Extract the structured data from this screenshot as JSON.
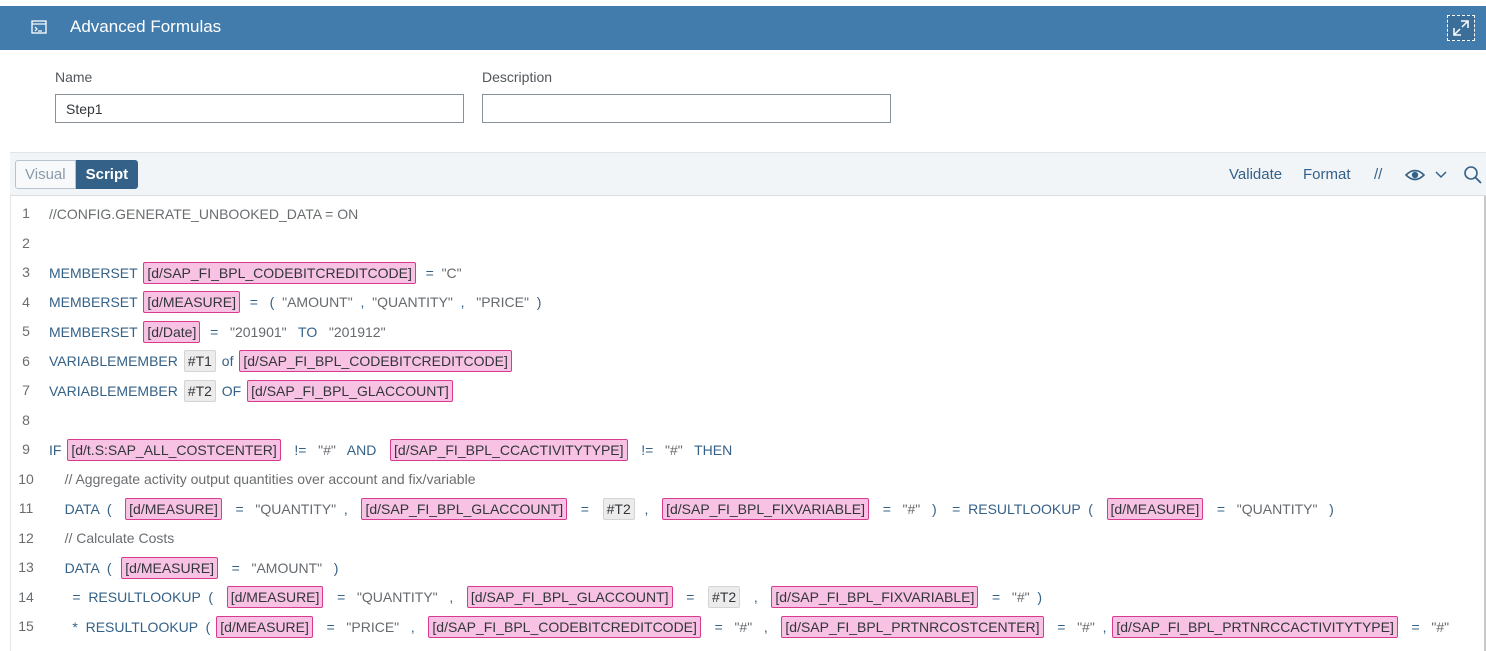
{
  "header": {
    "title": "Advanced Formulas",
    "title_icon": "console-icon",
    "expand_icon": "expand-icon"
  },
  "form": {
    "name_label": "Name",
    "name_value": "Step1",
    "description_label": "Description",
    "description_value": ""
  },
  "toolbar": {
    "tabs": [
      {
        "label": "Visual",
        "selected": false
      },
      {
        "label": "Script",
        "selected": true
      }
    ],
    "validate": "Validate",
    "format": "Format",
    "comment": "//",
    "icons": [
      "eye-icon",
      "chevron-down-icon",
      "search-icon"
    ]
  },
  "editor": {
    "lines": [
      {
        "n": "1",
        "indent": "",
        "tokens": [
          [
            "c",
            "//CONFIG.GENERATE_UNBOOKED_DATA = ON"
          ]
        ]
      },
      {
        "n": "2",
        "indent": "",
        "tokens": []
      },
      {
        "n": "3",
        "indent": "",
        "tokens": [
          [
            "k",
            "MEMBERSET "
          ],
          [
            "d",
            "[d/SAP_FI_BPL_CODEBITCREDITCODE]"
          ],
          [
            "o",
            "  =  "
          ],
          [
            "s",
            "\"C\""
          ]
        ]
      },
      {
        "n": "4",
        "indent": "",
        "tokens": [
          [
            "k",
            "MEMBERSET "
          ],
          [
            "d",
            "[d/MEASURE]"
          ],
          [
            "o",
            "  =   (  "
          ],
          [
            "s",
            "\"AMOUNT\""
          ],
          [
            "o",
            "  ,  "
          ],
          [
            "s",
            "\"QUANTITY\""
          ],
          [
            "o",
            "  ,   "
          ],
          [
            "s",
            "\"PRICE\""
          ],
          [
            "o",
            "  )"
          ]
        ]
      },
      {
        "n": "5",
        "indent": "",
        "tokens": [
          [
            "k",
            "MEMBERSET "
          ],
          [
            "d",
            "[d/Date]"
          ],
          [
            "o",
            "  =   "
          ],
          [
            "s",
            "\"201901\""
          ],
          [
            "k",
            "   TO   "
          ],
          [
            "s",
            "\"201912\""
          ]
        ]
      },
      {
        "n": "6",
        "indent": "",
        "tokens": [
          [
            "k",
            "VARIABLEMEMBER "
          ],
          [
            "v",
            "#T1"
          ],
          [
            "k",
            " of "
          ],
          [
            "d",
            "[d/SAP_FI_BPL_CODEBITCREDITCODE]"
          ]
        ]
      },
      {
        "n": "7",
        "indent": "",
        "tokens": [
          [
            "k",
            "VARIABLEMEMBER "
          ],
          [
            "v",
            "#T2"
          ],
          [
            "k",
            " OF "
          ],
          [
            "d",
            "[d/SAP_FI_BPL_GLACCOUNT]"
          ]
        ]
      },
      {
        "n": "8",
        "indent": "",
        "tokens": []
      },
      {
        "n": "9",
        "indent": "",
        "tokens": [
          [
            "k",
            "IF "
          ],
          [
            "d",
            "[d/t.S:SAP_ALL_COSTCENTER]"
          ],
          [
            "o",
            "   !=   "
          ],
          [
            "s",
            "\"#\""
          ],
          [
            "k",
            "   AND   "
          ],
          [
            "d",
            "[d/SAP_FI_BPL_CCACTIVITYTYPE]"
          ],
          [
            "o",
            "   !=   "
          ],
          [
            "s",
            "\"#\""
          ],
          [
            "k",
            "   THEN"
          ]
        ]
      },
      {
        "n": "10",
        "indent": "    ",
        "tokens": [
          [
            "c",
            "// Aggregate activity output quantities over account and fix/variable"
          ]
        ]
      },
      {
        "n": "11",
        "indent": "    ",
        "tokens": [
          [
            "k",
            "DATA  (   "
          ],
          [
            "d",
            "[d/MEASURE]"
          ],
          [
            "o",
            "   =   "
          ],
          [
            "s",
            "\"QUANTITY\""
          ],
          [
            "o",
            "  ,   "
          ],
          [
            "d",
            "[d/SAP_FI_BPL_GLACCOUNT]"
          ],
          [
            "o",
            "   =   "
          ],
          [
            "v",
            "#T2"
          ],
          [
            "o",
            "  ,   "
          ],
          [
            "d",
            "[d/SAP_FI_BPL_FIXVARIABLE]"
          ],
          [
            "o",
            "   =   "
          ],
          [
            "s",
            "\"#\""
          ],
          [
            "o",
            "   )    =  "
          ],
          [
            "k",
            "RESULTLOOKUP  (   "
          ],
          [
            "d",
            "[d/MEASURE]"
          ],
          [
            "o",
            "   =   "
          ],
          [
            "s",
            "\"QUANTITY\""
          ],
          [
            "o",
            "   )"
          ]
        ]
      },
      {
        "n": "12",
        "indent": "    ",
        "tokens": [
          [
            "c",
            "// Calculate Costs"
          ]
        ]
      },
      {
        "n": "13",
        "indent": "    ",
        "tokens": [
          [
            "k",
            "DATA  (  "
          ],
          [
            "d",
            "[d/MEASURE]"
          ],
          [
            "o",
            "   =   "
          ],
          [
            "s",
            "\"AMOUNT\""
          ],
          [
            "o",
            "   )"
          ]
        ]
      },
      {
        "n": "14",
        "indent": "     ",
        "tokens": [
          [
            "o",
            " =  "
          ],
          [
            "k",
            "RESULTLOOKUP  (   "
          ],
          [
            "d",
            "[d/MEASURE]"
          ],
          [
            "o",
            "   =   "
          ],
          [
            "s",
            "\"QUANTITY\""
          ],
          [
            "o",
            "   ,   "
          ],
          [
            "d",
            "[d/SAP_FI_BPL_GLACCOUNT]"
          ],
          [
            "o",
            "   =   "
          ],
          [
            "v",
            "#T2"
          ],
          [
            "o",
            "   ,   "
          ],
          [
            "d",
            "[d/SAP_FI_BPL_FIXVARIABLE]"
          ],
          [
            "o",
            "   =   "
          ],
          [
            "s",
            "\"#\""
          ],
          [
            "o",
            "  )"
          ]
        ]
      },
      {
        "n": "15",
        "indent": "     ",
        "tokens": [
          [
            "o",
            " *  "
          ],
          [
            "k",
            "RESULTLOOKUP  ( "
          ],
          [
            "d",
            "[d/MEASURE]"
          ],
          [
            "o",
            "   =   "
          ],
          [
            "s",
            "\"PRICE\""
          ],
          [
            "o",
            "   ,   "
          ],
          [
            "d",
            "[d/SAP_FI_BPL_CODEBITCREDITCODE]"
          ],
          [
            "o",
            "   =   "
          ],
          [
            "s",
            "\"#\""
          ],
          [
            "o",
            "   ,   "
          ],
          [
            "d",
            "[d/SAP_FI_BPL_PRTNRCOSTCENTER]"
          ],
          [
            "o",
            "   =   "
          ],
          [
            "s",
            "\"#\""
          ],
          [
            "o",
            "  , "
          ],
          [
            "d",
            "[d/SAP_FI_BPL_PRTNRCCACTIVITYTYPE]"
          ],
          [
            "o",
            "   =   "
          ],
          [
            "s",
            "\"#\""
          ]
        ]
      }
    ]
  }
}
